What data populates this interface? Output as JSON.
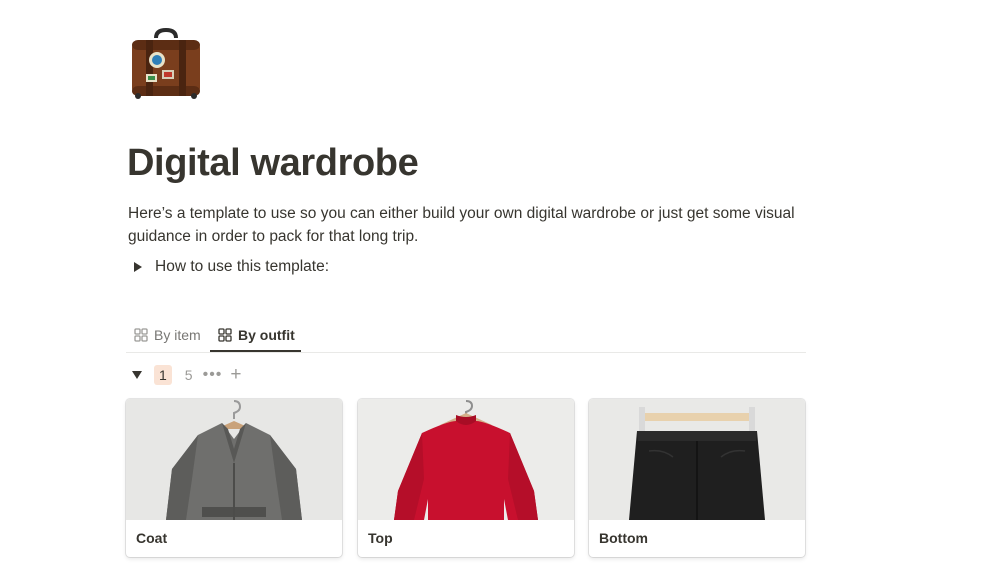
{
  "page": {
    "icon": "suitcase-icon",
    "title": "Digital wardrobe",
    "description": "Here’s a template to use so you can either build your own digital wardrobe or just get some visual guidance in order to pack for that long trip.",
    "toggle_label": "How to use this template:"
  },
  "views": {
    "tabs": [
      {
        "label": "By item",
        "icon": "gallery-icon",
        "active": false
      },
      {
        "label": "By outfit",
        "icon": "gallery-icon",
        "active": true
      }
    ]
  },
  "group": {
    "value": "1",
    "count": "5",
    "more_icon": "more-icon",
    "add_icon": "plus-icon",
    "badge_color": "#fae3d5"
  },
  "cards": [
    {
      "title": "Coat",
      "image": "grey-coat-on-hanger"
    },
    {
      "title": "Top",
      "image": "red-sweater-on-hanger"
    },
    {
      "title": "Bottom",
      "image": "black-skirt-on-hanger"
    }
  ]
}
